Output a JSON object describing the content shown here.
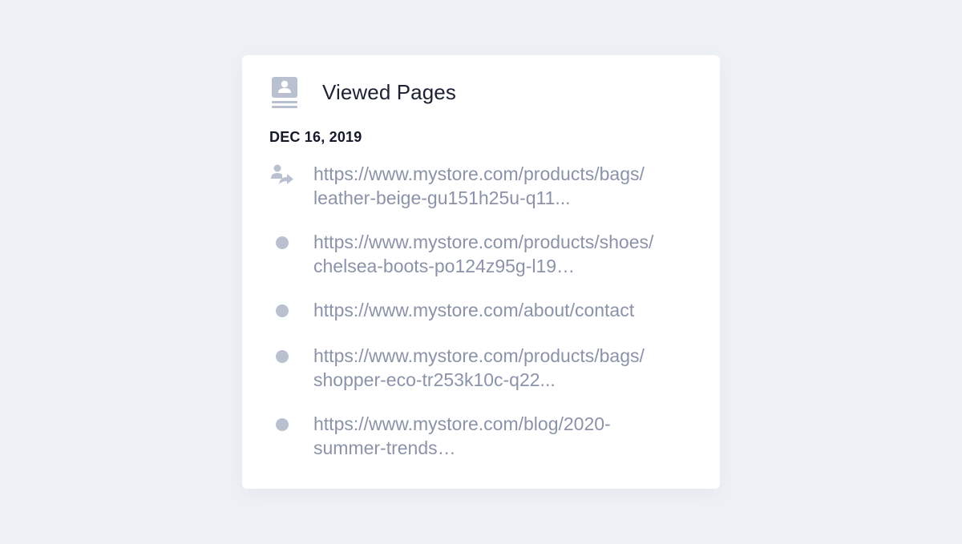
{
  "card": {
    "title": "Viewed Pages",
    "title_icon": "contact-card-icon",
    "date": "DEC 16, 2019"
  },
  "visits": [
    {
      "icon": "entry-arrow-icon",
      "line1": "https://www.mystore.com/products/bags/",
      "line2": "leather-beige-gu151h25u-q11..."
    },
    {
      "icon": "dot-icon",
      "line1": "https://www.mystore.com/products/shoes/",
      "line2": "chelsea-boots-po124z95g-l19…"
    },
    {
      "icon": "dot-icon",
      "line1": "https://www.mystore.com/about/contact",
      "line2": ""
    },
    {
      "icon": "dot-icon",
      "line1": "https://www.mystore.com/products/bags/",
      "line2": "shopper-eco-tr253k10c-q22..."
    },
    {
      "icon": "dot-icon",
      "line1": "https://www.mystore.com/blog/2020-",
      "line2": "summer-trends…"
    }
  ],
  "colors": {
    "background": "#eef1f5",
    "card": "#ffffff",
    "title_text": "#1b2233",
    "link_text": "#8a93a8",
    "icon_gray": "#b9c1d0"
  }
}
